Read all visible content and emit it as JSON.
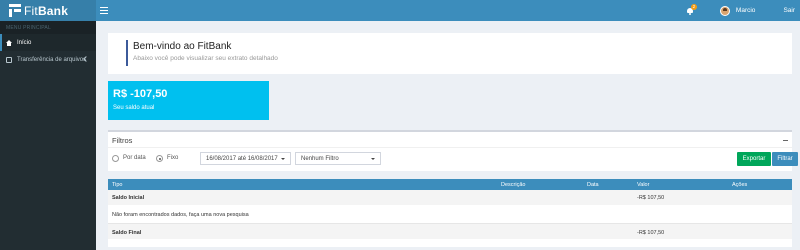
{
  "app": {
    "brand_light": "Fit",
    "brand_bold": "Bank",
    "notifications": "2",
    "user_name": "Marcio",
    "logout": "Sair"
  },
  "sidebar": {
    "header": "MENU PRINCIPAL",
    "items": [
      {
        "label": "Início",
        "icon": "home-icon",
        "active": true
      },
      {
        "label": "Transferência de arquivos",
        "icon": "transfer-icon",
        "active": false
      }
    ]
  },
  "welcome": {
    "title": "Bem-vindo ao FitBank",
    "subtitle": "Abaixo você pode visualizar seu extrato detalhado"
  },
  "balance": {
    "value": "R$ -107,50",
    "label": "Seu saldo atual",
    "color": "#00c0ef"
  },
  "filters": {
    "title": "Filtros",
    "radio_por_data": "Por data",
    "radio_fixo": "Fixo",
    "selected_radio": "Fixo",
    "date_range": "16/08/2017 até 16/08/2017",
    "filter_select": "Nenhum Filtro",
    "export_button": "Exportar",
    "filter_button": "Filtrar"
  },
  "table": {
    "columns": [
      "Tipo",
      "Descrição",
      "Data",
      "Valor",
      "Ações"
    ],
    "rows": [
      {
        "tipo": "Saldo Inicial",
        "valor": "-R$ 107,50"
      },
      {
        "message": "Não foram encontrados dados, faça uma nova pesquisa"
      },
      {
        "tipo": "Saldo Final",
        "valor": "-R$ 107,50"
      }
    ]
  },
  "colors": {
    "header": "#3c8dbc",
    "sidebar": "#222d32",
    "export": "#00a65a",
    "filter": "#3c8dbc"
  }
}
